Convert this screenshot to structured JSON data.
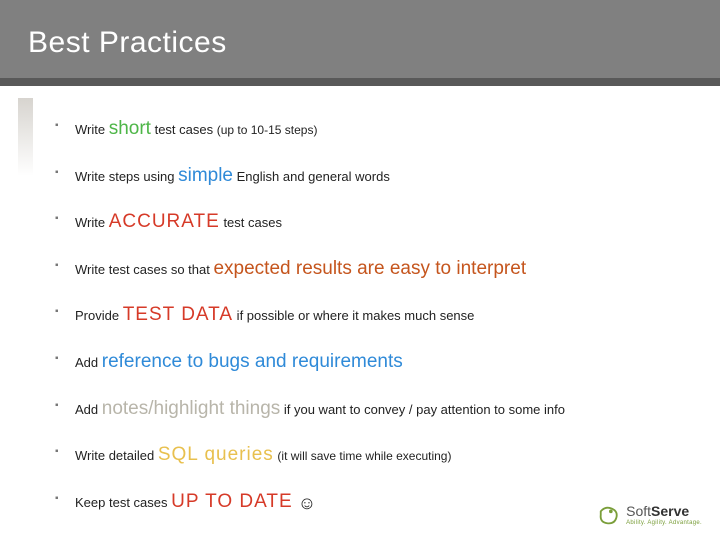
{
  "title": "Best Practices",
  "bullets": {
    "b1a": "Write ",
    "b1h": "short",
    "b1b": " test cases ",
    "b1p": "(up to 10-15 steps)",
    "b2a": "Write steps using ",
    "b2h": "simple",
    "b2b": " English and general words",
    "b3a": "Write ",
    "b3h": "ACCURATE",
    "b3b": "  test cases",
    "b4a": "Write test cases so that ",
    "b4h": "expected results are easy to interpret",
    "b5a": "Provide ",
    "b5h": "TEST DATA",
    "b5b": " if possible or where it makes much sense",
    "b6a": "Add ",
    "b6h": "reference to bugs and requirements",
    "b7a": "Add ",
    "b7h": "notes/highlight things",
    "b7b": " if you want to convey / pay attention to some info",
    "b8a": "Write detailed ",
    "b8h": "SQL queries",
    "b8b": " ",
    "b8p": "(it will save time while executing)",
    "b9a": "Keep test cases ",
    "b9h": "UP TO DATE",
    "b9e": " ☺"
  },
  "logo": {
    "name_light": "Soft",
    "name_bold": "Serve",
    "tagline": "Ability. Agility. Advantage."
  }
}
